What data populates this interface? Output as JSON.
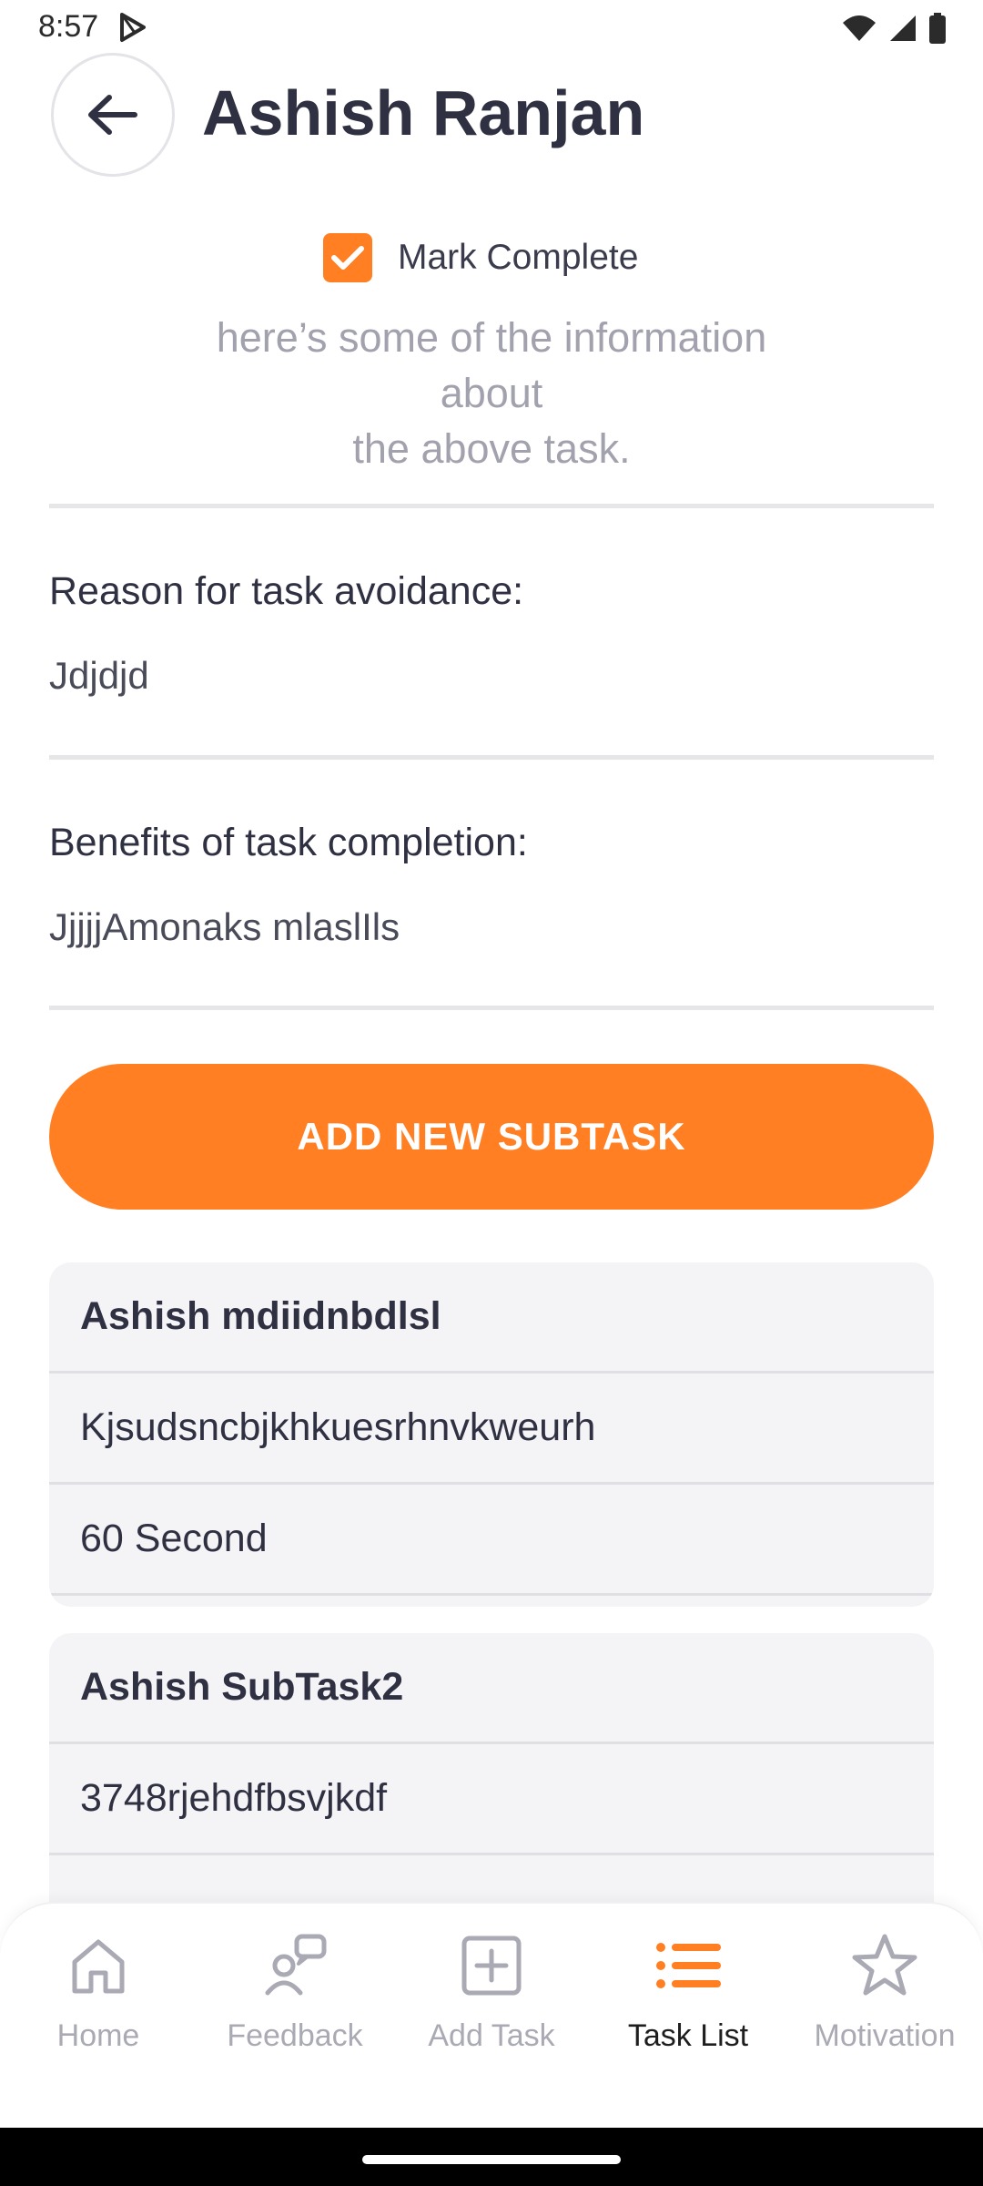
{
  "status_bar": {
    "time": "8:57",
    "icons": [
      "play-store-icon",
      "wifi-icon",
      "signal-icon",
      "battery-icon"
    ]
  },
  "header": {
    "title": "Ashish Ranjan",
    "back_icon": "arrow-left-icon"
  },
  "task": {
    "mark_complete_label": "Mark Complete",
    "mark_complete_checked": true,
    "info_line1": "here’s some of the information",
    "info_line2": "about",
    "info_line3": "the above task.",
    "reason_heading": "Reason for task avoidance:",
    "reason_value": "Jdjdjd",
    "benefits_heading": "Benefits of task completion:",
    "benefits_value": "JjjjjAmonaks mlaslIls"
  },
  "add_subtask_label": "ADD NEW SUBTASK",
  "subtasks": [
    {
      "title": "Ashish mdiidnbdlsl",
      "description": "Kjsudsncbjkhkuesrhnvkweurh",
      "duration": "60 Second"
    },
    {
      "title": "Ashish SubTask2",
      "description": "3748rjehdfbsvjkdf",
      "duration": ""
    }
  ],
  "bottom_nav": {
    "items": [
      {
        "label": "Home",
        "icon": "home-icon"
      },
      {
        "label": "Feedback",
        "icon": "feedback-icon"
      },
      {
        "label": "Add Task",
        "icon": "add-task-icon"
      },
      {
        "label": "Task List",
        "icon": "task-list-icon"
      },
      {
        "label": "Motivation",
        "icon": "star-icon"
      }
    ],
    "active_index": 3
  },
  "colors": {
    "accent": "#ff7f22",
    "text_dark": "#2f3042",
    "text_muted": "#a1a2ad",
    "card_bg": "#f4f4f6"
  }
}
